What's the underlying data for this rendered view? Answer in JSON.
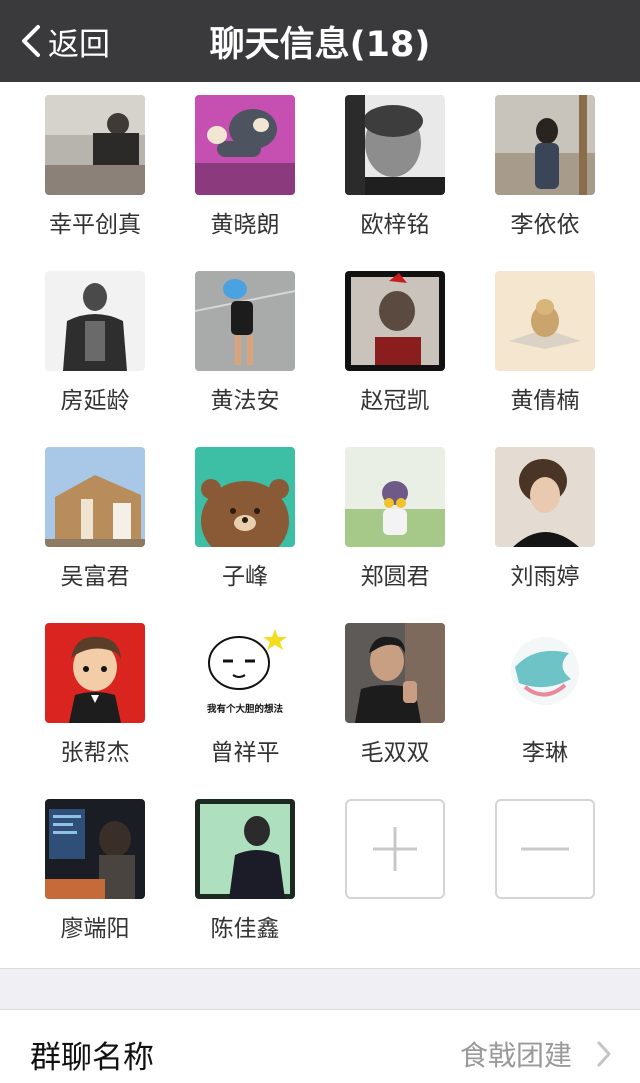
{
  "navbar": {
    "back_label": "返回",
    "title": "聊天信息(18)"
  },
  "members": [
    {
      "name": "幸平创真"
    },
    {
      "name": "黄晓朗"
    },
    {
      "name": "欧梓铭"
    },
    {
      "name": "李依依"
    },
    {
      "name": "房延龄"
    },
    {
      "name": "黄法安"
    },
    {
      "name": "赵冠凯"
    },
    {
      "name": "黄倩楠"
    },
    {
      "name": "吴富君"
    },
    {
      "name": "子峰"
    },
    {
      "name": "郑圆君"
    },
    {
      "name": "刘雨婷"
    },
    {
      "name": "张帮杰"
    },
    {
      "name": "曾祥平",
      "avatar_caption": "我有个大胆的想法"
    },
    {
      "name": "毛双双"
    },
    {
      "name": "李琳"
    },
    {
      "name": "廖端阳"
    },
    {
      "name": "陈佳鑫"
    }
  ],
  "actions": {
    "add_icon": "plus-icon",
    "remove_icon": "minus-icon"
  },
  "group_name": {
    "label": "群聊名称",
    "value": "食戟团建"
  },
  "colors": {
    "navbar_bg": "#3a3a3c",
    "separator_bg": "#efeff4",
    "secondary_text": "#9a9a9a"
  }
}
